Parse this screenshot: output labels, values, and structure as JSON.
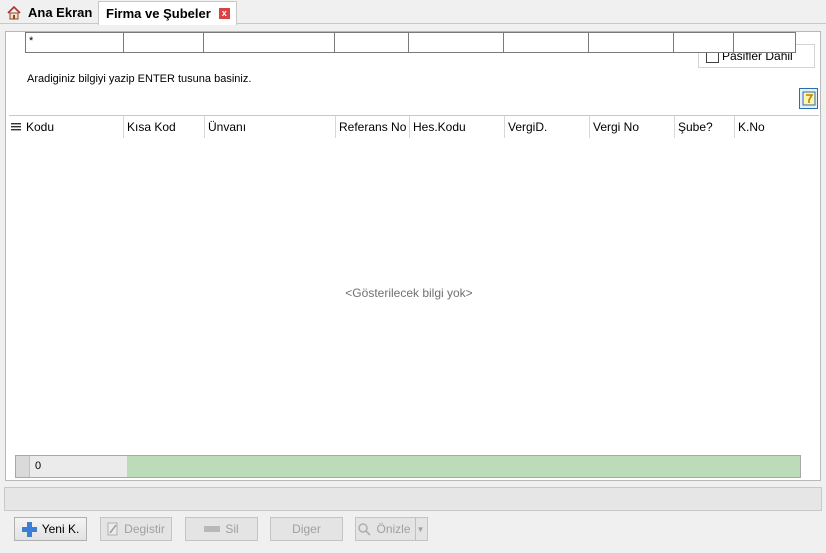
{
  "tabs": {
    "home_label": "Ana Ekran",
    "active_label": "Firma ve Şubeler",
    "close_symbol": "x"
  },
  "filter": {
    "pasif_label": "Pasifler Dahil",
    "pasif_checked": false,
    "hint": "Aradiginiz bilgiyi yazip ENTER tusuna basiniz.",
    "first_value": "*"
  },
  "grid": {
    "columns": [
      "Kodu",
      "Kısa Kod",
      "Ünvanı",
      "Referans No",
      "Hes.Kodu",
      "VergiD.",
      "Vergi No",
      "Şube?",
      "K.No"
    ],
    "empty_message": "<Gösterilecek bilgi yok>",
    "record_count": "0"
  },
  "buttons": {
    "new_label": "Yeni K.",
    "edit_label": "Degistir",
    "delete_label": "Sil",
    "other_label": "Diger",
    "preview_label": "Önizle"
  },
  "colors": {
    "footer_fill": "#bcdbb8",
    "new_icon": "#3a7fd5"
  }
}
